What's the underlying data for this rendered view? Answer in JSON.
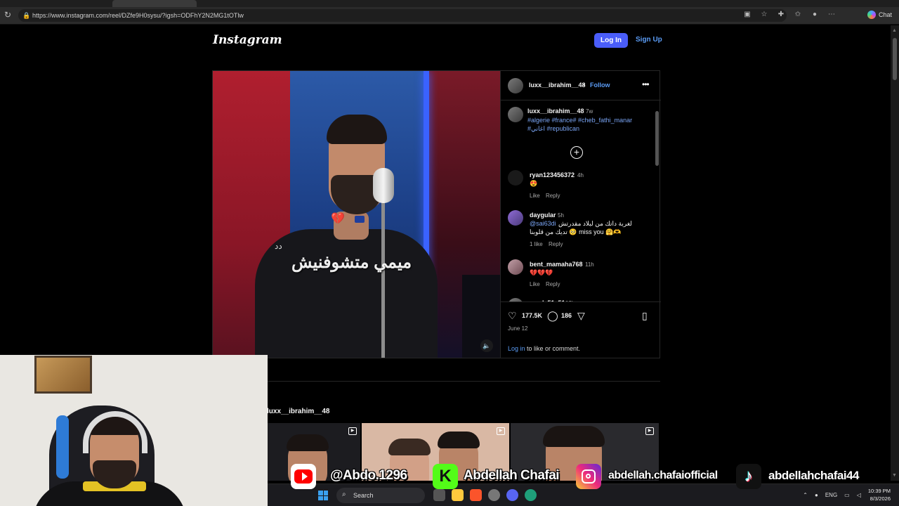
{
  "browser": {
    "url": "https://www.instagram.com/reel/DZfe9H0sysu/?igsh=ODFhY2N2MG1tOTlw",
    "copilot_label": "Chat",
    "toolbar_icons": [
      "split-screen-icon",
      "star-icon",
      "extensions-icon",
      "favorites-icon",
      "profile-icon",
      "more-icon"
    ]
  },
  "instagram": {
    "logo": "Instagram",
    "login_button": "Log In",
    "signup_link": "Sign Up"
  },
  "post": {
    "author": "luxx__ibrahim__48",
    "dot": "•",
    "follow": "Follow",
    "caption_user": "luxx__ibrahim__48",
    "caption_time": "7w",
    "hashtags": "#algerie #france# #cheb_fathi_manar #اغاني #republican",
    "video_overlay_text": "ميمي متشوفنيش",
    "video_overlay_prefix": "دد",
    "comments": [
      {
        "user": "ryan123456372",
        "time": "4h",
        "text": "😍",
        "like": "Like",
        "reply": "Reply"
      },
      {
        "user": "daygular",
        "time": "5h",
        "mention": "@sai63di",
        "text_line1": "لغربة داتك من لبلاد مقدرتش",
        "text_line2": "تديك من قلوبنا 🥺 miss you 🤗🫶",
        "likes": "1 like",
        "reply": "Reply"
      },
      {
        "user": "bent_mamaha768",
        "time": "11h",
        "text": "💔💔💔",
        "like": "Like",
        "reply": "Reply"
      },
      {
        "user": "amal_51_51",
        "time": "12h"
      }
    ],
    "likes_count": "177.5K",
    "comments_count": "186",
    "date": "June 12",
    "login_link": "Log in",
    "login_suffix": " to like or comment."
  },
  "more_posts": {
    "user": "luxx__ibrahim__48"
  },
  "overlay": {
    "youtube": "@Abdo.1296",
    "kick": "Abdellah Chafai",
    "kick_icon_letter": "K",
    "instagram": "abdellah.chafaiofficial",
    "tiktok": "abdellahchafai44",
    "tiktok_icon_glyph": "♪"
  },
  "taskbar": {
    "search_label": "Search",
    "language": "ENG",
    "time": "10:39 PM",
    "date": "8/3/2026"
  },
  "colors": {
    "accent_blue": "#4a5df9",
    "link_blue": "#5b9cf5",
    "youtube_red": "#ff0000",
    "kick_green": "#53fc18"
  }
}
